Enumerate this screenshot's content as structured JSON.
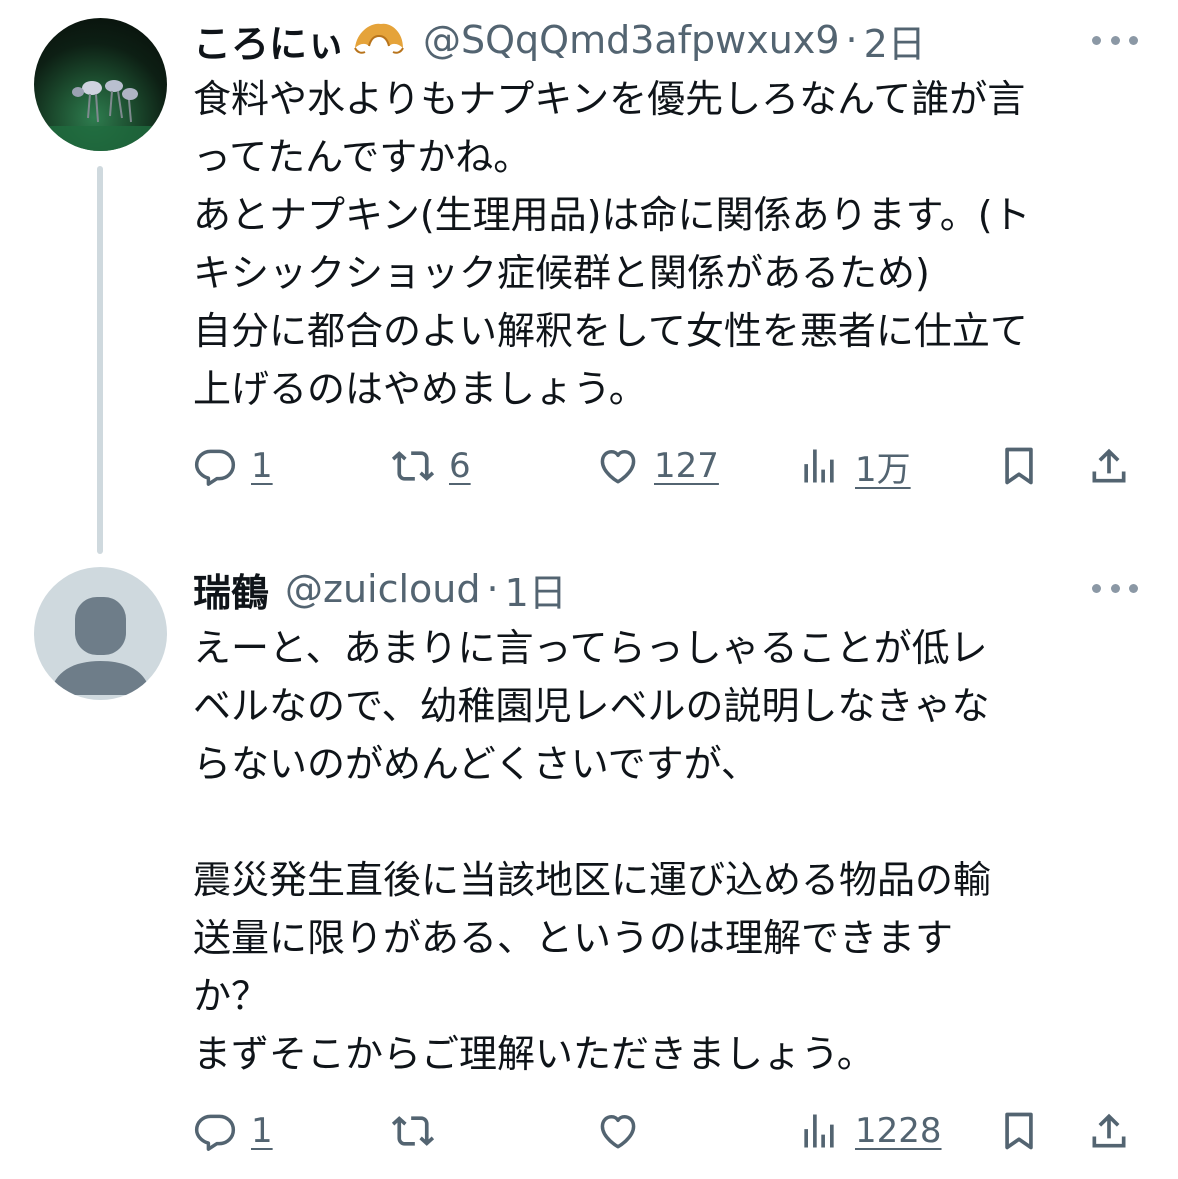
{
  "tweets": [
    {
      "name": "ころにぃ",
      "handle": "@SQqQmd3afpwxux9",
      "separator": "·",
      "time": "2日",
      "lines": [
        "食料や水よりもナプキンを優先しろなんて誰が言",
        "ってたんですかね。",
        "あとナプキン(生理用品)は命に関係あります。(ト",
        "キシックショック症候群と関係があるため)",
        "自分に都合のよい解釈をして女性を悪者に仕立て",
        "上げるのはやめましょう。"
      ],
      "replies": "1",
      "retweets": "6",
      "likes": "127",
      "views": "1万"
    },
    {
      "name": "瑞鶴",
      "handle": "@zuicloud",
      "separator": "·",
      "time": "1日",
      "lines": [
        "えーと、あまりに言ってらっしゃることが低レ",
        "ベルなので、幼稚園児レベルの説明しなきゃな",
        "らないのがめんどくさいですが、",
        "",
        "震災発生直後に当該地区に運び込める物品の輸",
        "送量に限りがある、というのは理解できます",
        "か？",
        "まずそこからご理解いただきましょう。"
      ],
      "replies": "1",
      "retweets": "",
      "likes": "",
      "views": "1228"
    }
  ],
  "icons": {
    "reply": "reply-icon",
    "retweet": "retweet-icon",
    "like": "heart-icon",
    "views": "views-icon",
    "bookmark": "bookmark-icon",
    "share": "share-icon",
    "more": "more-icon",
    "emoji": "croissant-emoji"
  },
  "colors": {
    "text": "#0f1419",
    "secondary": "#536471",
    "thread_line": "#cfd9de",
    "default_avatar_bg": "#cfd9de",
    "default_avatar_fg": "#6e7d89"
  }
}
